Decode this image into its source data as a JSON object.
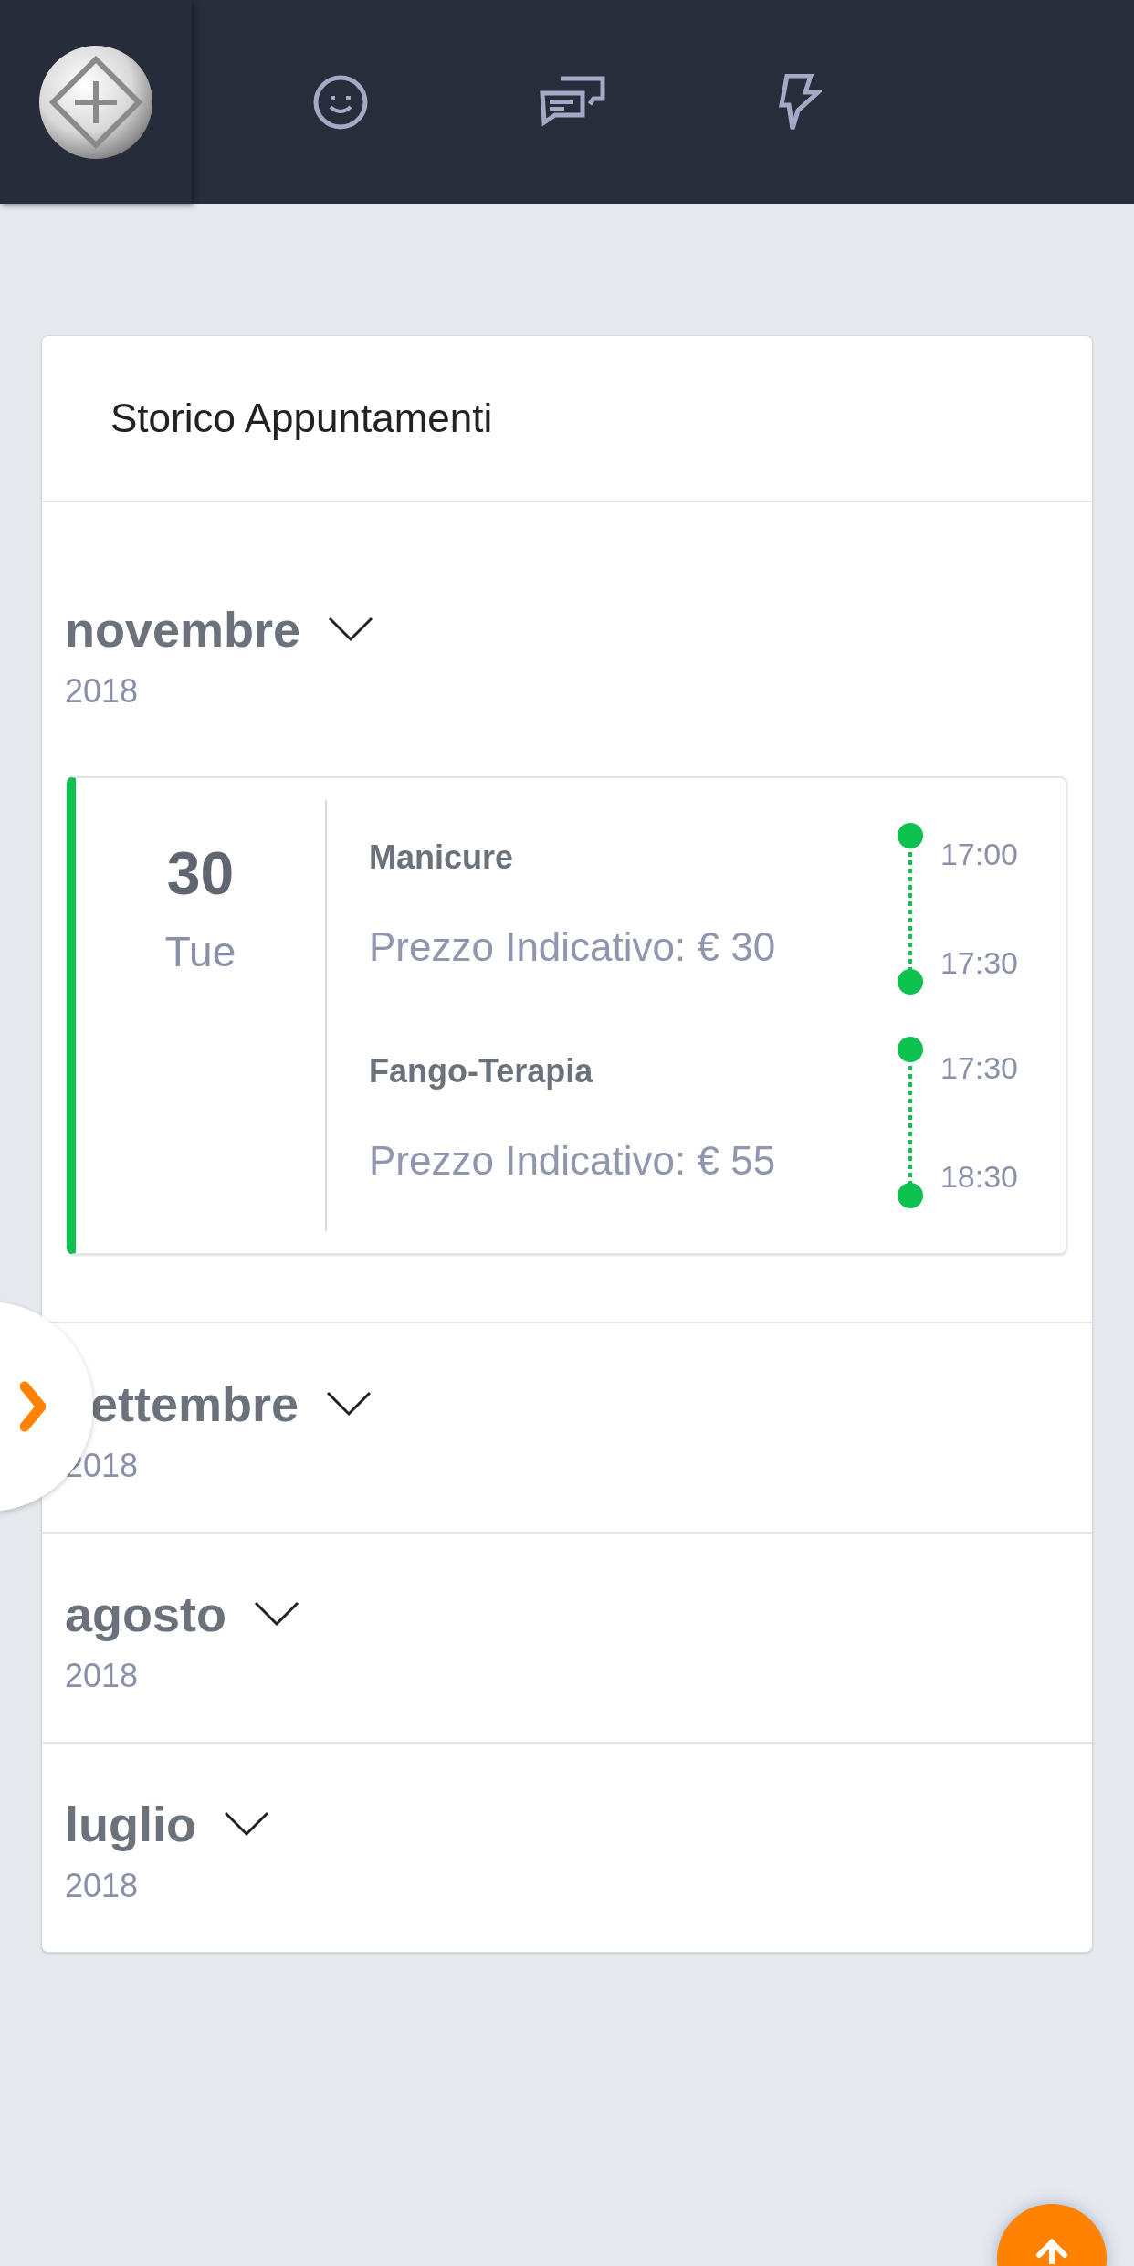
{
  "nav": {
    "tabs": [
      {
        "kind": "face"
      },
      {
        "kind": "chat"
      },
      {
        "kind": "bolt"
      }
    ]
  },
  "panel": {
    "title": "Storico Appuntamenti",
    "months": [
      {
        "name": "novembre",
        "year": "2018",
        "drawer_tab": false,
        "days": [
          {
            "day": "30",
            "weekday": "Tue",
            "appointments": [
              {
                "service": "Manicure",
                "price": "Prezzo Indicativo: € 30",
                "start": "17:00",
                "end": "17:30"
              },
              {
                "service": "Fango-Terapia",
                "price": "Prezzo Indicativo: € 55",
                "start": "17:30",
                "end": "18:30"
              }
            ]
          }
        ]
      },
      {
        "name": "ettembre",
        "year": "2018",
        "drawer_tab": true
      },
      {
        "name": "agosto",
        "year": "2018",
        "drawer_tab": false
      },
      {
        "name": "luglio",
        "year": "2018",
        "drawer_tab": false
      }
    ]
  }
}
